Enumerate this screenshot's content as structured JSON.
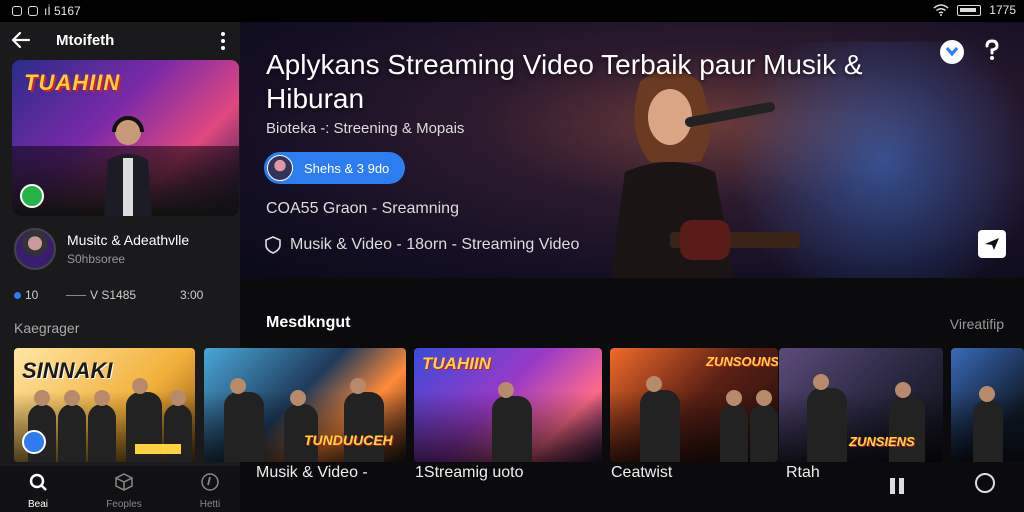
{
  "status_bar": {
    "left_text": "ıİ 5167",
    "right_time": "1775",
    "right_text": "5167"
  },
  "left_panel": {
    "title": "Mtoifeth",
    "feature_thumb_text": "TUAHIIN",
    "artist_name": "Musitc & Adeathvlle",
    "artist_sub": "S0hbsoree",
    "stats": [
      "10",
      "V S1485",
      "3:00"
    ],
    "section_label": "Kaegrager"
  },
  "hero": {
    "title": "Aplykans Streaming Video Terbaik paur Musik & Hiburan",
    "subtitle": "Bioteka -: Streening & Mopais",
    "chip_label": "Shehs & 3 9do",
    "meta_line": "COA55 Graon - Sreamning",
    "meta_line2": "Musik & Video -  18orn - Streaming Video"
  },
  "section": {
    "title": "Mesdkngut",
    "more_link": "Vireatifip"
  },
  "cards": [
    {
      "title": "SINNAKI"
    },
    {
      "title": "TUNDUUCEH"
    },
    {
      "title": "TUAHIIN"
    },
    {
      "title": "ZUNSOUNS"
    },
    {
      "title": "ZUNSIENS"
    },
    {
      "title": ""
    }
  ],
  "card_captions": [
    "Musik & Video  -",
    "1Streamig uoto",
    "Ceatwist",
    "Rtah"
  ],
  "bottom_nav": [
    {
      "label": "Beai",
      "icon": "search-icon",
      "active": true
    },
    {
      "label": "Feoples",
      "icon": "cube-icon",
      "active": false
    },
    {
      "label": "Hetti",
      "icon": "compass-icon",
      "active": false
    }
  ],
  "colors": {
    "accent": "#2d7cf0",
    "background": "#0b0b0d",
    "panel": "#1a1a1c"
  }
}
